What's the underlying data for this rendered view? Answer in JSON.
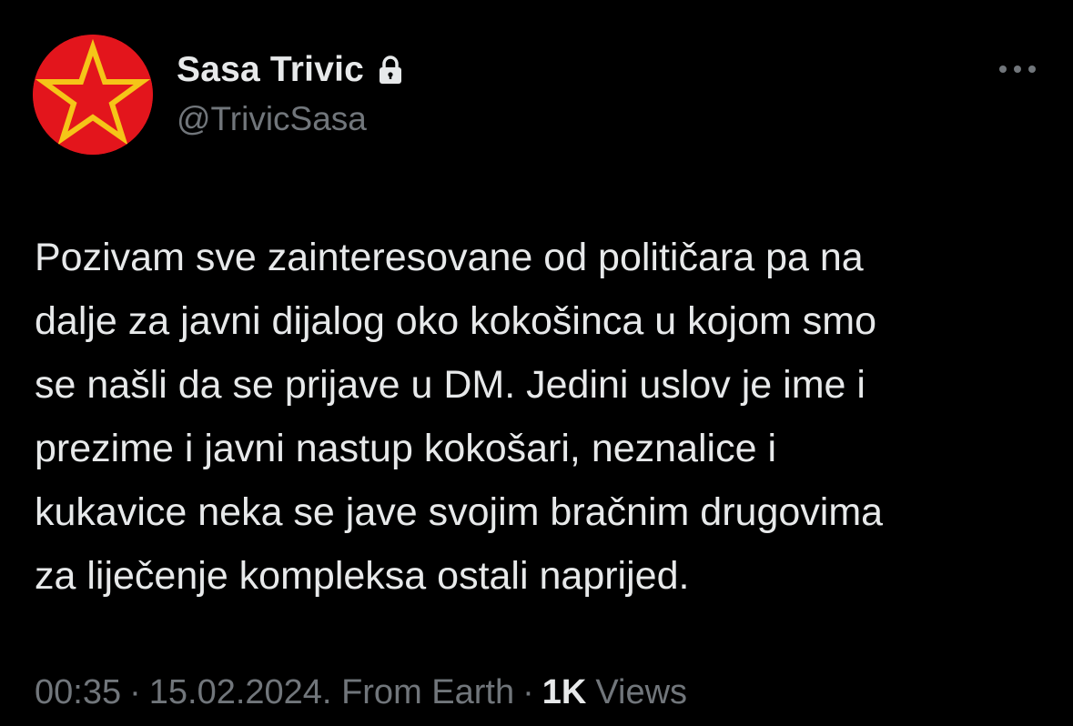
{
  "tweet": {
    "author": {
      "display_name": "Sasa Trivic",
      "handle": "@TrivicSasa",
      "protected_icon": "lock-icon",
      "avatar_icon": "red-star-icon"
    },
    "more_icon": "more-horizontal-icon",
    "text": "Pozivam sve zainteresovane od političara pa na\ndalje za javni  dijalog oko kokošinca u kojom smo\nse našli da se prijave u DM. Jedini uslov je ime i\nprezime i javni nastup kokošari, neznalice i\nkukavice neka se jave svojim bračnim drugovima\nza liječenje kompleksa ostali naprijed.",
    "time": "00:35",
    "date": "15.02.2024.",
    "source": "From Earth",
    "separator": "·",
    "views_count": "1K",
    "views_label": "Views"
  },
  "colors": {
    "background": "#000000",
    "primary_text": "#e7e9ea",
    "secondary_text": "#71767b",
    "avatar_red": "#e3151c",
    "avatar_star": "#f5c518"
  }
}
